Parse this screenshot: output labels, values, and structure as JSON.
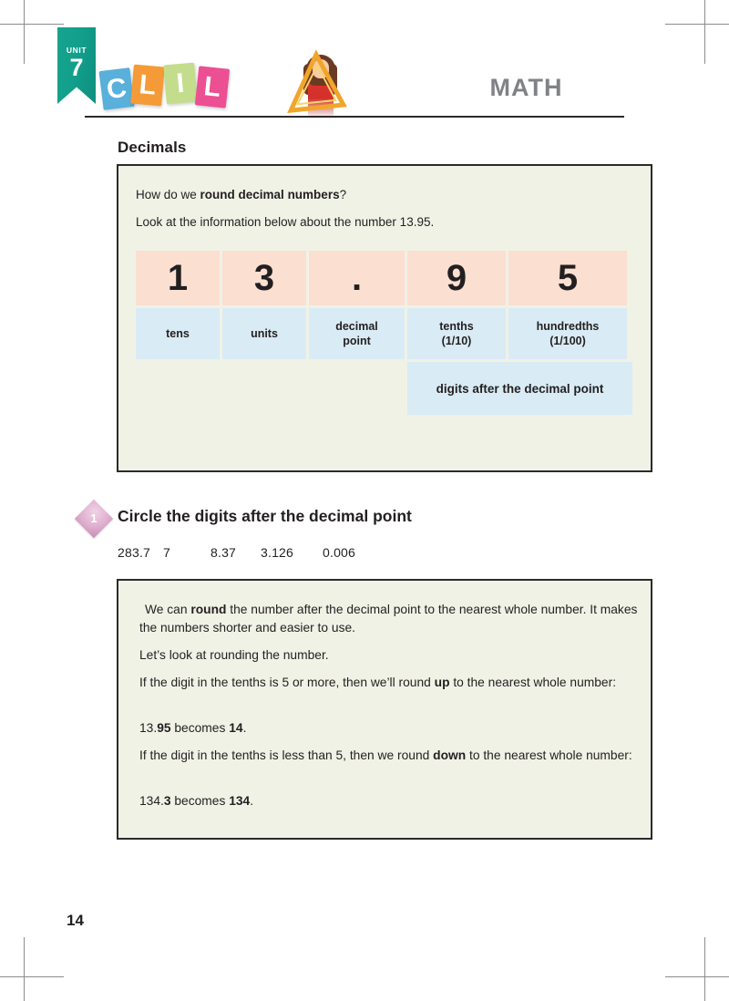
{
  "header": {
    "unit_word": "UNIT",
    "unit_number": "7",
    "brand_letters": [
      "C",
      "L",
      "I",
      "L"
    ],
    "subject_title": "MATH",
    "illustration_name": "girl-with-triangle-ruler"
  },
  "section": {
    "title": "Decimals"
  },
  "info_panel": {
    "question_prefix": "How do we ",
    "question_bold": "round decimal numbers",
    "question_suffix": "?",
    "instruction": "Look at the information below about the number 13.95.",
    "table": {
      "digits": [
        "1",
        "3",
        ".",
        "9",
        "5"
      ],
      "labels": [
        "tens",
        "units",
        "decimal point",
        "tenths (1/10)",
        "hundredths (1/100)"
      ],
      "label_lines": [
        [
          "tens"
        ],
        [
          "units"
        ],
        [
          "decimal",
          "point"
        ],
        [
          "tenths",
          "(1/10)"
        ],
        [
          "hundredths",
          "(1/100)"
        ]
      ],
      "note": "digits after the decimal point"
    }
  },
  "exercise": {
    "number": "1",
    "title": "Circle the digits after the decimal point",
    "numbers": [
      "283.7",
      "7",
      "8.37",
      "3.126",
      "0.006"
    ]
  },
  "explanation_panel": {
    "lines": [
      " We can round the number after the decimal point to the nearest whole number. It makes the numbers shorter and easier to use.",
      "Let’s look at rounding the number.",
      "If the digit in the tenths is 5 or more, then we’ll round up to the nearest whole number:",
      "13.95 becomes 14.",
      "If the digit in the tenths is less than 5, then we round down to the nearest whole number:",
      "134.3 becomes 134."
    ],
    "l0_a": " We can ",
    "l0_b": "round",
    "l0_c": " the number after the decimal point to the nearest whole number. It makes the numbers shorter and easier to use.",
    "l1": "Let’s look at rounding the number.",
    "l2_a": "If the digit in the tenths is 5 or more, then we’ll round ",
    "l2_b": "up",
    "l2_c": " to the nearest whole number:",
    "l3_a": "13.",
    "l3_b": "95",
    "l3_c": " becomes ",
    "l3_d": "14",
    "l3_e": ".",
    "l4_a": "If the digit in the tenths is less than 5, then we round ",
    "l4_b": "down",
    "l4_c": " to the nearest whole number:",
    "l5_a": "134.",
    "l5_b": "3",
    "l5_c": " becomes ",
    "l5_d": "134",
    "l5_e": "."
  },
  "footer": {
    "page_number": "14"
  },
  "colors": {
    "ribbon_teal": "#12a08c",
    "tile_blue": "#58b0db",
    "tile_orange": "#f49b38",
    "tile_green": "#c3dd8c",
    "tile_pink": "#ec4f92",
    "title_grey": "#808285",
    "panel_bg": "#f0f2e6",
    "panel_border": "#2b2b2b",
    "cell_peach": "#fbdfd1",
    "cell_blue": "#d9ebf5",
    "badge_pink": "#dfb0cf"
  }
}
